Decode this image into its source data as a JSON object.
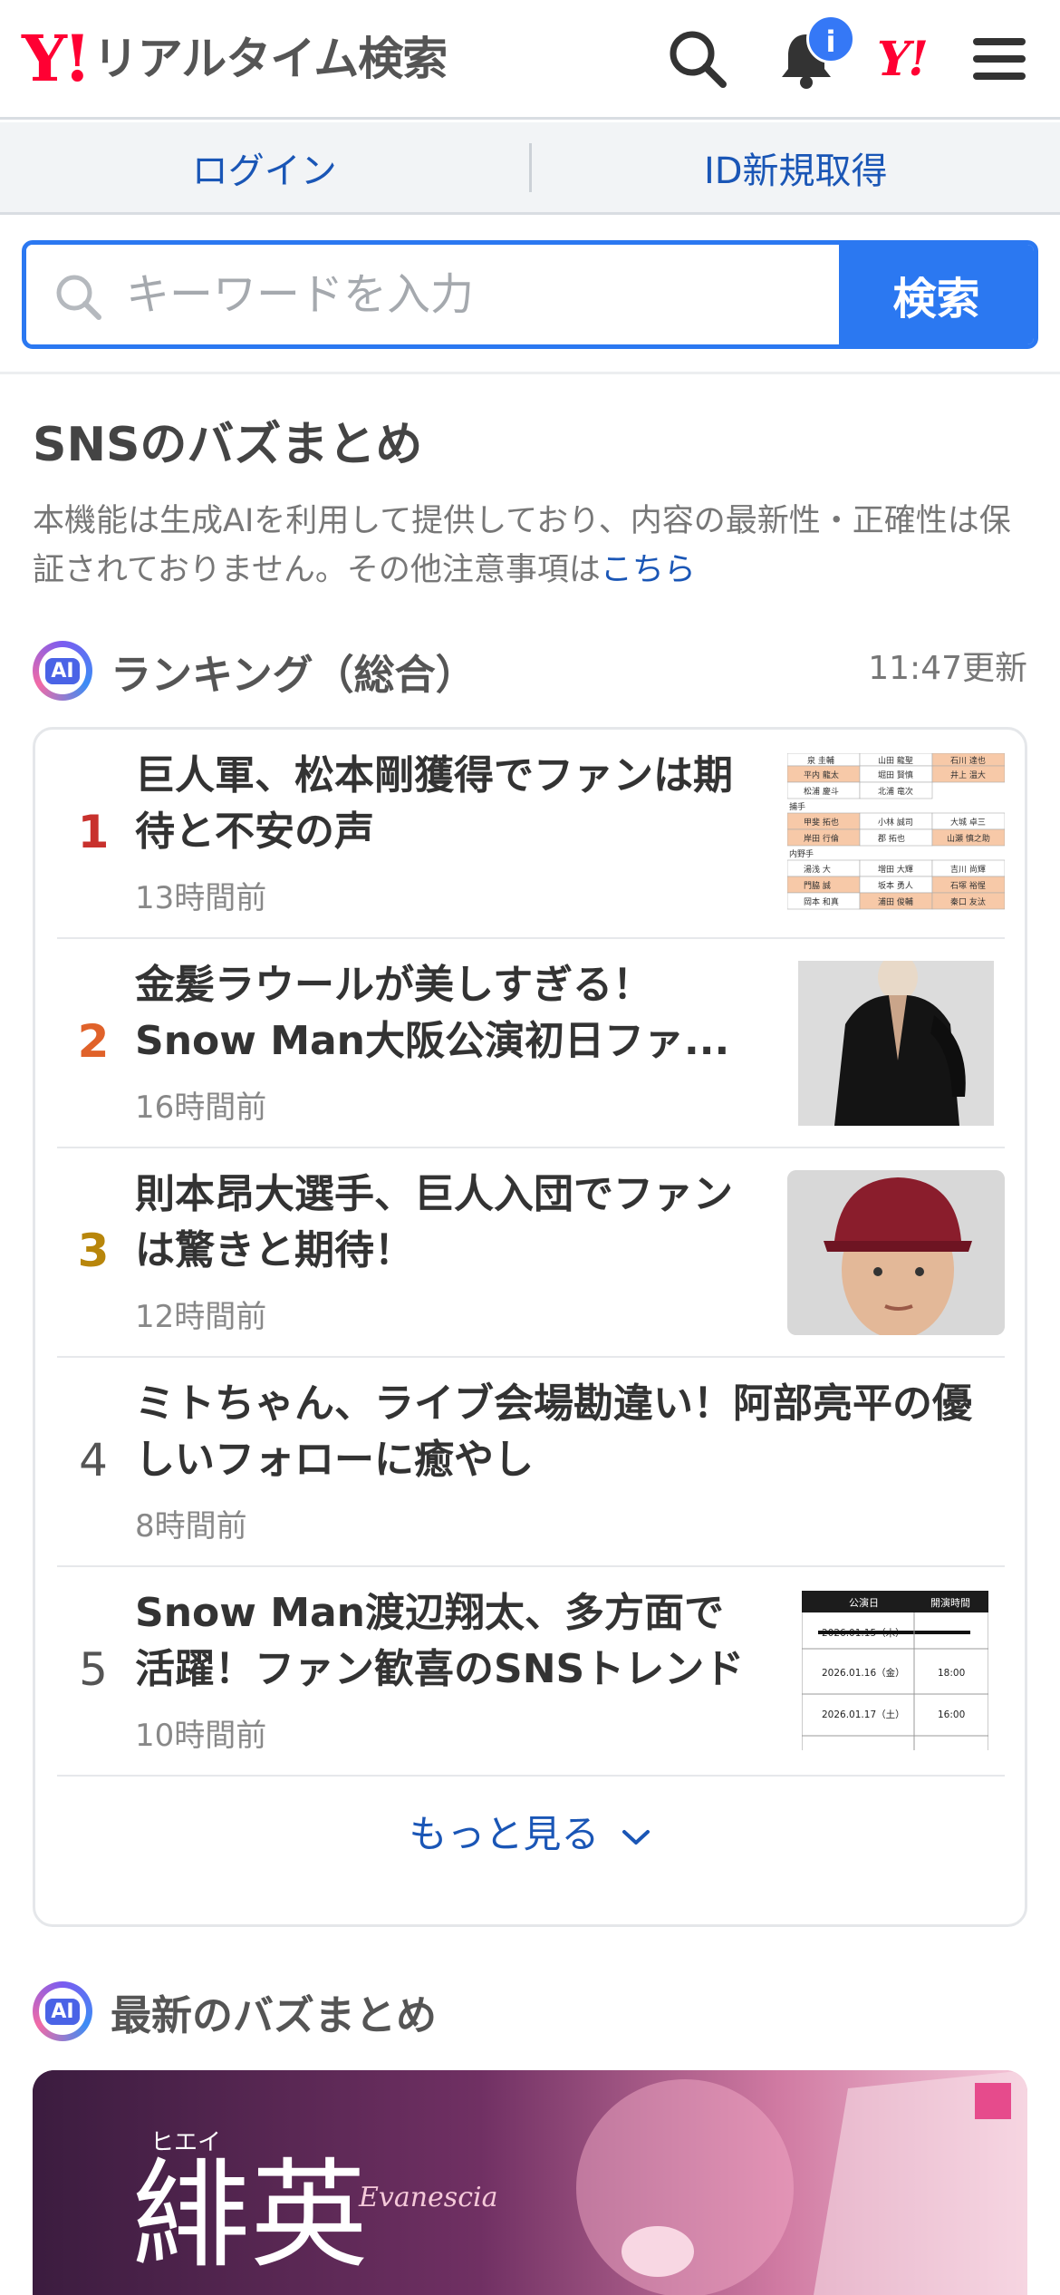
{
  "header": {
    "logo_mark": "Y!",
    "logo_text": "リアルタイム検索",
    "notification_badge": "i",
    "yjapan_mark": "Y!"
  },
  "loginbar": {
    "login": "ログイン",
    "register": "ID新規取得"
  },
  "search": {
    "placeholder": "キーワードを入力",
    "value": "",
    "button": "検索"
  },
  "sns": {
    "title": "SNSのバズまとめ",
    "notice": "本機能は生成AIを利用して提供しており、内容の最新性・正確性は保証されておりません。その他注意事項は",
    "notice_link": "こちら"
  },
  "ranking": {
    "ai_label": "AI",
    "title": "ランキング（総合）",
    "updated": "11:47更新",
    "items": [
      {
        "rank": "1",
        "title_l1": "巨人軍、松本剛獲得でファンは期",
        "title_l2": "待と不安の声",
        "time": "13時間前",
        "rank_color": "#c8312d",
        "thumb": "baseball-roster-table"
      },
      {
        "rank": "2",
        "title_l1": "金髪ラウールが美しすぎる！",
        "title_l2": "Snow Man大阪公演初日ファ...",
        "time": "16時間前",
        "rank_color": "#e0622a",
        "thumb": "person-in-black-jacket"
      },
      {
        "rank": "3",
        "title_l1": "則本昂大選手、巨人入団でファン",
        "title_l2": "は驚きと期待！",
        "time": "12時間前",
        "rank_color": "#b8860b",
        "thumb": "player-in-red-cap"
      },
      {
        "rank": "4",
        "title_l1": "ミトちゃん、ライブ会場勘違い！阿部亮平の優",
        "title_l2": "しいフォローに癒やし",
        "time": "8時間前",
        "rank_color": "#555555",
        "thumb": ""
      },
      {
        "rank": "5",
        "title_l1": "Snow Man渡辺翔太、多方面で",
        "title_l2": "活躍！ファン歓喜のSNSトレンド",
        "time": "10時間前",
        "rank_color": "#555555",
        "thumb": "performance-schedule-table"
      }
    ],
    "more": "もっと見る"
  },
  "thumb_tables": {
    "roster": {
      "header_row": [
        "泉 圭輔",
        "山田 龍聖",
        "石川 達也"
      ],
      "rows1": [
        [
          "平内 龍太",
          "堀田 賢慎",
          "井上 温大"
        ],
        [
          "松浦 慶斗",
          "北浦 竜次",
          ""
        ]
      ],
      "section2": "捕手",
      "rows2": [
        [
          "甲斐 拓也",
          "小林 誠司",
          "大城 卓三"
        ],
        [
          "岸田 行倫",
          "郡 拓也",
          "山瀬 慎之助"
        ]
      ],
      "section3": "内野手",
      "rows3": [
        [
          "湯浅 大",
          "増田 大輝",
          "吉川 尚輝"
        ],
        [
          "門脇 誠",
          "坂本 勇人",
          "石塚 裕惺"
        ],
        [
          "岡本 和真",
          "浦田 俊輔",
          "秦口 友汰"
        ]
      ]
    },
    "schedule": {
      "col1": "公演日",
      "col2": "開演時間",
      "struck": "2026.01.15（木）",
      "rows": [
        [
          "2026.01.16（金）",
          "18:00"
        ],
        [
          "2026.01.17（土）",
          "16:00"
        ]
      ]
    }
  },
  "latest": {
    "ai_label": "AI",
    "title": "最新のバズまとめ",
    "banner_text": "緋英",
    "banner_sub": "Evanescia",
    "banner_ruby": "ヒエイ"
  }
}
